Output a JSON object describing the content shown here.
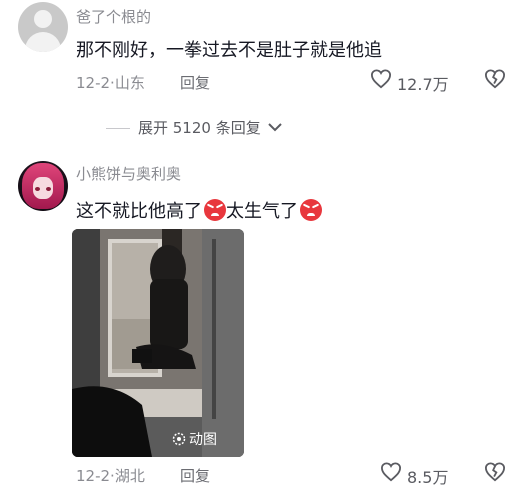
{
  "comments": [
    {
      "username": "爸了个根的",
      "text": "那不刚好，一拳过去不是肚子就是他追",
      "date": "12-2",
      "location": "山东",
      "reply_label": "回复",
      "likes": "12.7万"
    },
    {
      "username": "小熊饼与奥利奥",
      "text_part1": "这不就比他高了",
      "text_part2": "太生气了",
      "date": "12-2",
      "location": "湖北",
      "reply_label": "回复",
      "likes": "8.5万",
      "media_badge": "动图"
    }
  ],
  "expand_replies": {
    "label": "展开 5120 条回复"
  },
  "icons": {
    "like": "heart-outline-icon",
    "dislike": "broken-heart-icon",
    "emoji": "angry-face-emoji",
    "expand": "chevron-down-icon",
    "gif": "gif-animation-icon"
  },
  "colors": {
    "text_primary": "#161823",
    "text_secondary": "#8a8b91",
    "emoji_red": "#e8373d"
  }
}
